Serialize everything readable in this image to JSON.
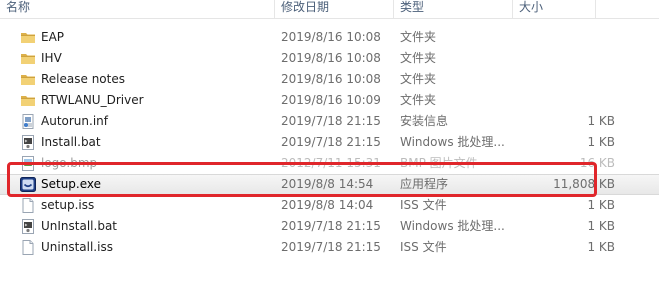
{
  "columns": {
    "name": "名称",
    "date": "修改日期",
    "type": "类型",
    "size": "大小"
  },
  "files": [
    {
      "name": "EAP",
      "date": "2019/8/16 10:08",
      "type": "文件夹",
      "size": "",
      "icon": "folder-icon"
    },
    {
      "name": "IHV",
      "date": "2019/8/16 10:08",
      "type": "文件夹",
      "size": "",
      "icon": "folder-icon"
    },
    {
      "name": "Release notes",
      "date": "2019/8/16 10:08",
      "type": "文件夹",
      "size": "",
      "icon": "folder-icon"
    },
    {
      "name": "RTWLANU_Driver",
      "date": "2019/8/16 10:09",
      "type": "文件夹",
      "size": "",
      "icon": "folder-icon"
    },
    {
      "name": "Autorun.inf",
      "date": "2019/7/18 21:15",
      "type": "安装信息",
      "size": "1 KB",
      "icon": "setup-info-icon"
    },
    {
      "name": "Install.bat",
      "date": "2019/7/18 21:15",
      "type": "Windows 批处理...",
      "size": "1 KB",
      "icon": "batch-file-icon"
    },
    {
      "name": "logo.bmp",
      "date": "2012/7/11 15:31",
      "type": "BMP 图片文件",
      "size": "16 KB",
      "icon": "image-file-icon"
    },
    {
      "name": "Setup.exe",
      "date": "2019/8/8 14:54",
      "type": "应用程序",
      "size": "11,808 KB",
      "icon": "setup-app-icon"
    },
    {
      "name": "setup.iss",
      "date": "2019/8/8 14:04",
      "type": "ISS 文件",
      "size": "1 KB",
      "icon": "blank-file-icon"
    },
    {
      "name": "UnInstall.bat",
      "date": "2019/7/18 21:15",
      "type": "Windows 批处理...",
      "size": "1 KB",
      "icon": "batch-file-icon"
    },
    {
      "name": "Uninstall.iss",
      "date": "2019/7/18 21:15",
      "type": "ISS 文件",
      "size": "1 KB",
      "icon": "blank-file-icon"
    }
  ],
  "selected_file": "Setup.exe",
  "colors": {
    "highlight_box": "#e0262b",
    "folder": "#e8c45a",
    "header_text": "#4c607a"
  }
}
